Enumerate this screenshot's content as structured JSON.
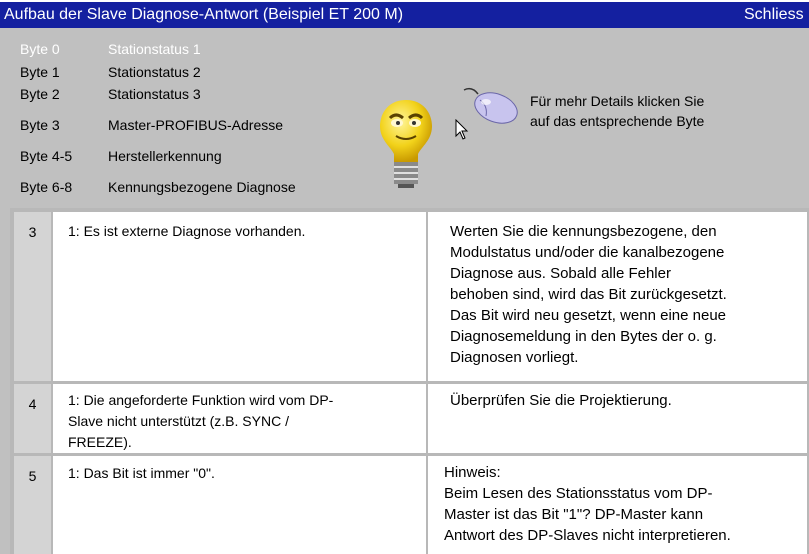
{
  "window": {
    "title": "Aufbau der Slave Diagnose-Antwort (Beispiel ET 200 M)",
    "close_label": "Schliess"
  },
  "bytes": [
    {
      "num": "Byte 0",
      "label": "Stationstatus 1"
    },
    {
      "num": "Byte 1",
      "label": "Stationstatus 2"
    },
    {
      "num": "Byte 2",
      "label": "Stationstatus 3"
    },
    {
      "num": "Byte 3",
      "label": "Master-PROFIBUS-Adresse"
    },
    {
      "num": "Byte 4-5",
      "label": "Herstellerkennung"
    },
    {
      "num": "Byte 6-8",
      "label": "Kennungsbezogene Diagnose"
    }
  ],
  "hint": {
    "line1": "Für mehr Details klicken Sie",
    "line2": "auf das entsprechende Byte"
  },
  "icons": {
    "bulb": "lightbulb-face-icon",
    "mouse": "computer-mouse-icon",
    "cursor": "arrow-cursor-icon"
  },
  "rows": [
    {
      "bit": "3",
      "meaning": "1: Es ist externe Diagnose vorhanden.",
      "remedy": "Werten Sie die kennungsbezogene, den\n   Modulstatus und/oder die kanalbezogene\n   Diagnose aus. Sobald alle Fehler\n   behoben sind, wird das Bit  zurückgesetzt.\n   Das Bit wird neu gesetzt, wenn eine neue\n   Diagnosemeldung in den Bytes der o. g.\n   Diagnosen vorliegt."
    },
    {
      "bit": "4",
      "meaning": "1: Die angeforderte Funktion wird vom DP-\n   Slave nicht unterstützt (z.B. SYNC /\n   FREEZE).",
      "remedy": "Überprüfen Sie die Projektierung."
    },
    {
      "bit": "5",
      "meaning": "1: Das Bit ist immer \"0\".",
      "remedy": "Hinweis:\nBeim Lesen des Stationsstatus vom DP-\nMaster ist das Bit \"1\"? DP-Master kann\nAntwort des DP-Slaves nicht interpretieren."
    }
  ],
  "colors": {
    "titlebar": "#1420a0",
    "background": "#c0c0c0",
    "active_item": "#ffffff"
  }
}
